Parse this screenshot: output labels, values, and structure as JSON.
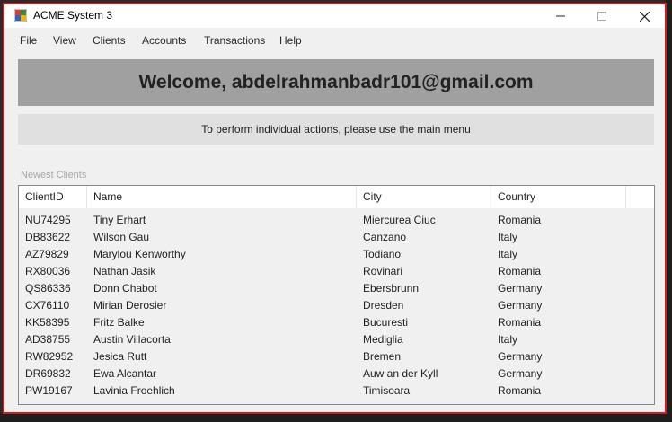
{
  "window": {
    "title": "ACME System 3",
    "minimize_glyph": "—",
    "maximize_glyph": "☐",
    "close_glyph": "✕"
  },
  "menu": {
    "items": [
      "File",
      "View",
      "Clients",
      "Accounts",
      "Transactions",
      "Help"
    ]
  },
  "welcome": {
    "text": "Welcome, abdelrahmanbadr101@gmail.com"
  },
  "info": {
    "text": "To perform individual actions, please use the main menu"
  },
  "newest_clients": {
    "label": "Newest Clients",
    "columns": [
      "ClientID",
      "Name",
      "City",
      "Country"
    ],
    "rows": [
      [
        "NU74295",
        "Tiny Erhart",
        "Miercurea Ciuc",
        "Romania"
      ],
      [
        "DB83622",
        "Wilson Gau",
        "Canzano",
        "Italy"
      ],
      [
        "AZ79829",
        "Marylou Kenworthy",
        "Todiano",
        "Italy"
      ],
      [
        "RX80036",
        "Nathan Jasik",
        "Rovinari",
        "Romania"
      ],
      [
        "QS86336",
        "Donn Chabot",
        "Ebersbrunn",
        "Germany"
      ],
      [
        "CX76110",
        "Mirian Derosier",
        "Dresden",
        "Germany"
      ],
      [
        "KK58395",
        "Fritz Balke",
        "Bucuresti",
        "Romania"
      ],
      [
        "AD38755",
        "Austin Villacorta",
        "Mediglia",
        "Italy"
      ],
      [
        "RW82952",
        "Jesica Rutt",
        "Bremen",
        "Germany"
      ],
      [
        "DR69832",
        "Ewa Alcantar",
        "Auw an der Kyll",
        "Germany"
      ],
      [
        "PW19167",
        "Lavinia Froehlich",
        "Timisoara",
        "Romania"
      ]
    ]
  },
  "colors": {
    "window_border": "#d01c1c",
    "welcome_bg": "#a0a0a0",
    "info_bg": "#e0e0e0"
  }
}
